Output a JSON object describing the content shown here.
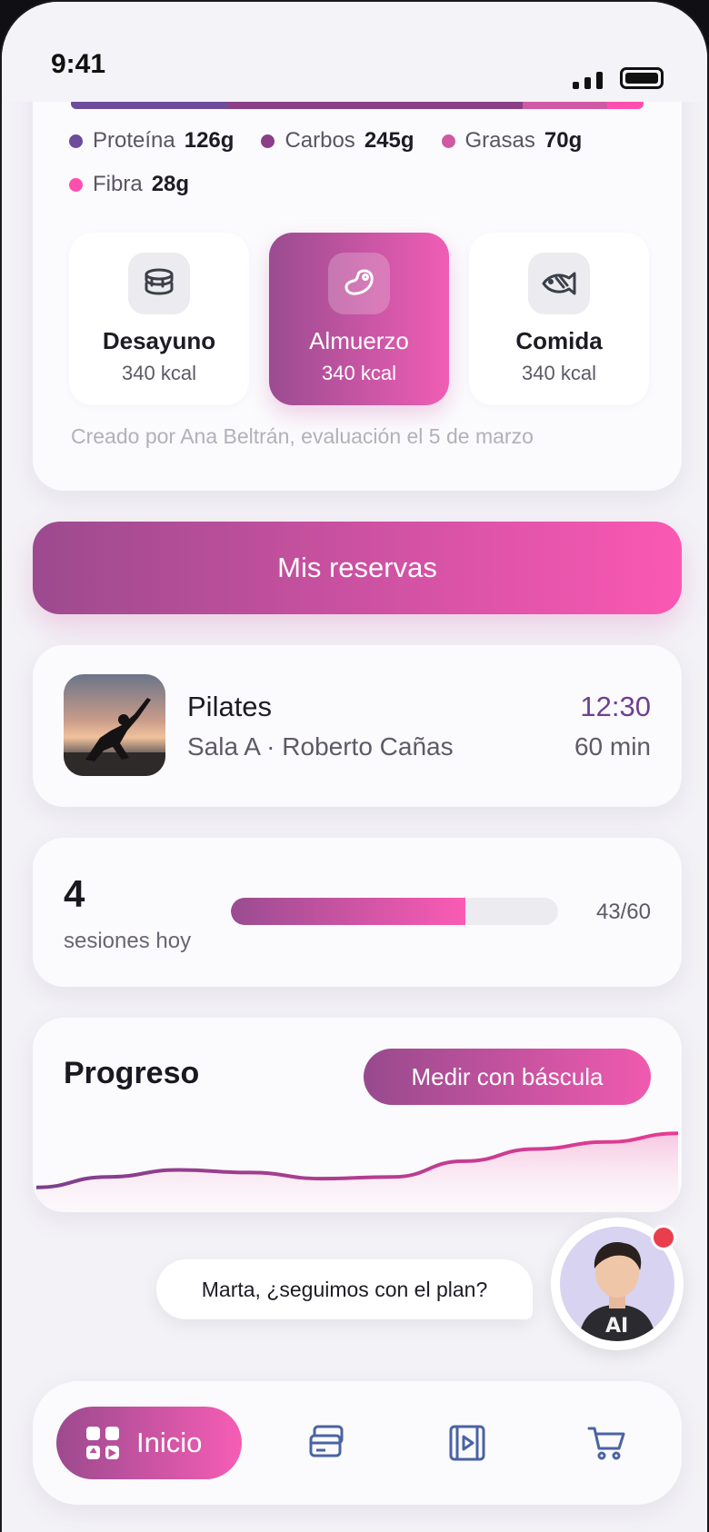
{
  "status_bar": {
    "time": "9:41"
  },
  "nutrition": {
    "macros": [
      {
        "name": "Proteína",
        "value": "126g",
        "color": "#6e4b9b",
        "share": 0.26
      },
      {
        "name": "Carbos",
        "value": "245g",
        "color": "#8a3f86",
        "share": 0.49
      },
      {
        "name": "Grasas",
        "value": "70g",
        "color": "#cf5aa3",
        "share": 0.14
      },
      {
        "name": "Fibra",
        "value": "28g",
        "color": "#ff4fae",
        "share": 0.06
      }
    ],
    "meals": [
      {
        "name": "Desayuno",
        "kcal": "340 kcal",
        "icon": "pancakes-icon",
        "active": false
      },
      {
        "name": "Almuerzo",
        "kcal": "340 kcal",
        "icon": "meat-icon",
        "active": true
      },
      {
        "name": "Comida",
        "kcal": "340 kcal",
        "icon": "fish-icon",
        "active": false
      }
    ],
    "creator_note": "Creado por Ana Beltrán, evaluación el 5 de marzo"
  },
  "reservations": {
    "label": "Mis reservas"
  },
  "class_item": {
    "title": "Pilates",
    "subtitle": "Sala A · Roberto Cañas",
    "time": "12:30",
    "duration": "60 min",
    "image": "yoga-pose-photo"
  },
  "sessions": {
    "count": "4",
    "label": "sesiones hoy",
    "progress_text": "43/60",
    "progress_fraction": 0.7167
  },
  "progress": {
    "title": "Progreso",
    "button": "Medir con báscula",
    "trend": [
      0.18,
      0.3,
      0.38,
      0.35,
      0.28,
      0.3,
      0.48,
      0.62,
      0.7,
      0.8
    ]
  },
  "assistant": {
    "message": "Marta, ¿seguimos con el plan?",
    "avatar_label": "AI",
    "has_notification": true
  },
  "bottom_nav": {
    "items": [
      {
        "label": "Inicio",
        "icon": "grid-icon",
        "active": true
      },
      {
        "label": "",
        "icon": "cards-icon",
        "active": false
      },
      {
        "label": "",
        "icon": "video-icon",
        "active": false
      },
      {
        "label": "",
        "icon": "cart-icon",
        "active": false
      }
    ]
  },
  "colors": {
    "accent_start": "#9c4a8f",
    "accent_end": "#fb58b3",
    "time_accent": "#6f3f93"
  }
}
